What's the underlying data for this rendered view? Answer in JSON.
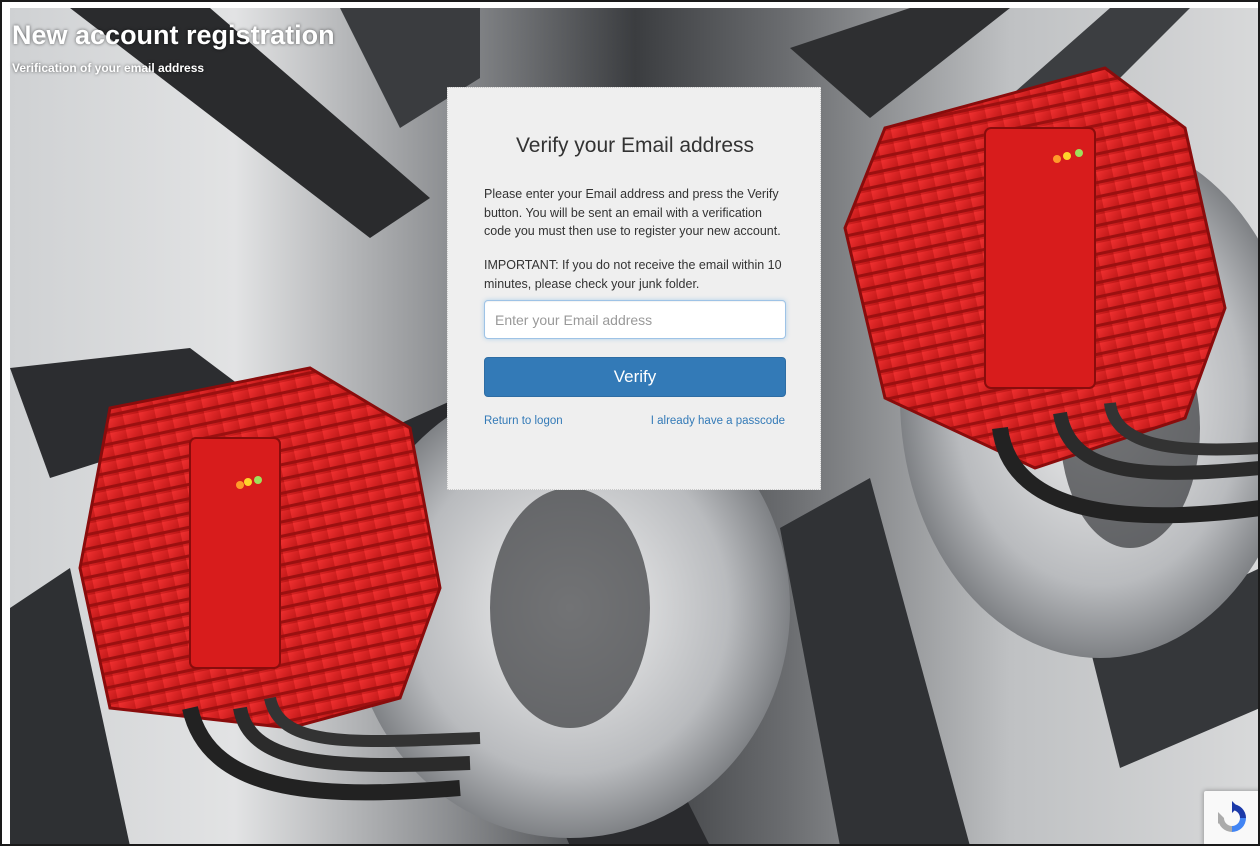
{
  "header": {
    "title": "New account registration",
    "subtitle": "Verification of your email address"
  },
  "card": {
    "heading": "Verify your Email address",
    "instructions": "Please enter your Email address and press the Verify button. You will be sent an email with a verification code you must then use to register your new account.",
    "important": "IMPORTANT: If you do not receive the email within 10 minutes, please check your junk folder.",
    "email_placeholder": "Enter your Email address",
    "email_value": "",
    "verify_label": "Verify",
    "return_link": "Return to logon",
    "passcode_link": "I already have a passcode"
  },
  "background": {
    "description_icon": "fan-motor-photo-icon",
    "accent_red": "#e02020"
  },
  "colors": {
    "primary_button": "#337ab7",
    "link": "#337ab7",
    "card_bg": "#efefef"
  },
  "recaptcha": {
    "icon": "recaptcha-icon"
  }
}
